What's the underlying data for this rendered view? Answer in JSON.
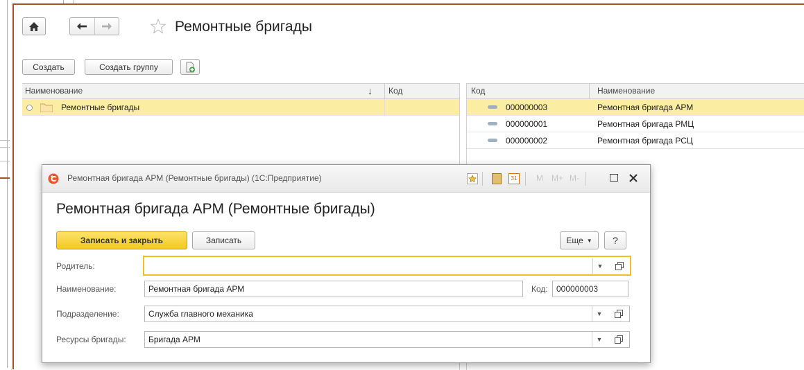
{
  "page": {
    "title": "Ремонтные бригады",
    "home_icon": "home-icon",
    "back_icon": "arrow-left-icon",
    "forward_icon": "arrow-right-icon",
    "star_icon": "star-icon"
  },
  "toolbar": {
    "create_label": "Создать",
    "create_group_label": "Создать группу",
    "add_icon": "add-document-icon"
  },
  "left_table": {
    "columns": [
      "Наименование",
      "Код"
    ],
    "sort_indicator": "↓",
    "rows": [
      {
        "name": "Ремонтные бригады",
        "code": ""
      }
    ]
  },
  "right_table": {
    "columns": [
      "Код",
      "Наименование"
    ],
    "rows": [
      {
        "code": "000000003",
        "name": "Ремонтная бригада АРМ"
      },
      {
        "code": "000000001",
        "name": "Ремонтная бригада РМЦ"
      },
      {
        "code": "000000002",
        "name": "Ремонтная бригада РСЦ"
      }
    ]
  },
  "dialog": {
    "window_title": "Ремонтная бригада АРМ (Ремонтные бригады)  (1С:Предприятие)",
    "heading": "Ремонтная бригада АРМ (Ремонтные бригады)",
    "titlebar_tools": [
      "M",
      "M+",
      "M-"
    ],
    "save_close_label": "Записать и закрыть",
    "save_label": "Записать",
    "more_label": "Еще",
    "help_label": "?",
    "fields": {
      "parent_label": "Родитель:",
      "parent_value": "",
      "name_label": "Наименование:",
      "name_value": "Ремонтная бригада АРМ",
      "code_label": "Код:",
      "code_value": "000000003",
      "division_label": "Подразделение:",
      "division_value": "Служба главного механика",
      "resources_label": "Ресурсы бригады:",
      "resources_value": "Бригада АРМ"
    }
  },
  "colors": {
    "accent_frame": "#a0522d",
    "selected_row": "#fbeda2",
    "primary_button": "#f5d130",
    "focus_border": "#f0c020"
  }
}
